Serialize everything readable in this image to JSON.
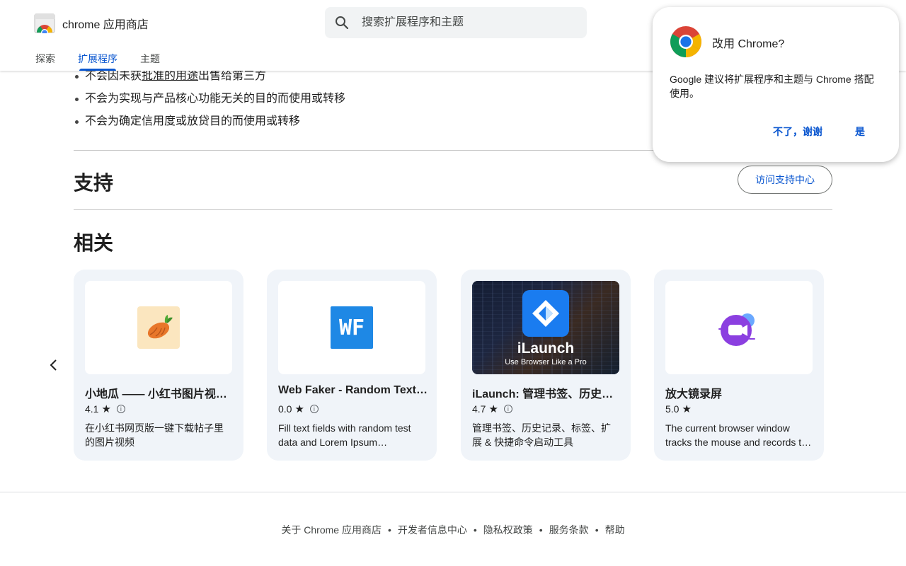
{
  "header": {
    "brand": "chrome 应用商店",
    "search_placeholder": "搜索扩展程序和主题",
    "tabs": [
      {
        "label": "探索",
        "active": false
      },
      {
        "label": "扩展程序",
        "active": true
      },
      {
        "label": "主题",
        "active": false
      }
    ]
  },
  "privacy": {
    "items": [
      {
        "before": "不会因未获",
        "link": "批准的用途",
        "after": "出售给第三方"
      },
      {
        "text": "不会为实现与产品核心功能无关的目的而使用或转移"
      },
      {
        "text": "不会为确定信用度或放贷目的而使用或转移"
      }
    ]
  },
  "support": {
    "title": "支持",
    "button": "访问支持中心"
  },
  "related": {
    "title": "相关",
    "cards": [
      {
        "name": "小地瓜 —— 小红书图片视频下载",
        "rating": "4.1",
        "desc": "在小红书网页版一键下载帖子里的图片视频",
        "icon": "sweet-potato-icon"
      },
      {
        "name": "Web Faker - Random Text Generator",
        "rating": "0.0",
        "desc": "Fill text fields with random test data and Lorem Ipsum placeholder text",
        "icon": "wf-icon"
      },
      {
        "name": "iLaunch: 管理书签、历史记录、标签",
        "rating": "4.7",
        "desc": "管理书签、历史记录、标签、扩展 & 快捷命令启动工具",
        "icon": "ilaunch-logo",
        "banner_title": "iLaunch",
        "banner_sub": "Use Browser Like a Pro"
      },
      {
        "name": "放大镜录屏",
        "rating": "5.0",
        "desc": "The current browser window tracks the mouse and records the screen",
        "icon": "camera-blob-icon"
      }
    ]
  },
  "footer": {
    "links": [
      "关于 Chrome 应用商店",
      "开发者信息中心",
      "隐私权政策",
      "服务条款",
      "帮助"
    ],
    "separator": "•"
  },
  "popup": {
    "title": "改用 Chrome?",
    "body": "Google 建议将扩展程序和主题与 Chrome 搭配使用。",
    "decline": "不了，谢谢",
    "accept": "是"
  },
  "colors": {
    "accent": "#0b57d0",
    "card_bg": "#f0f4f9"
  }
}
